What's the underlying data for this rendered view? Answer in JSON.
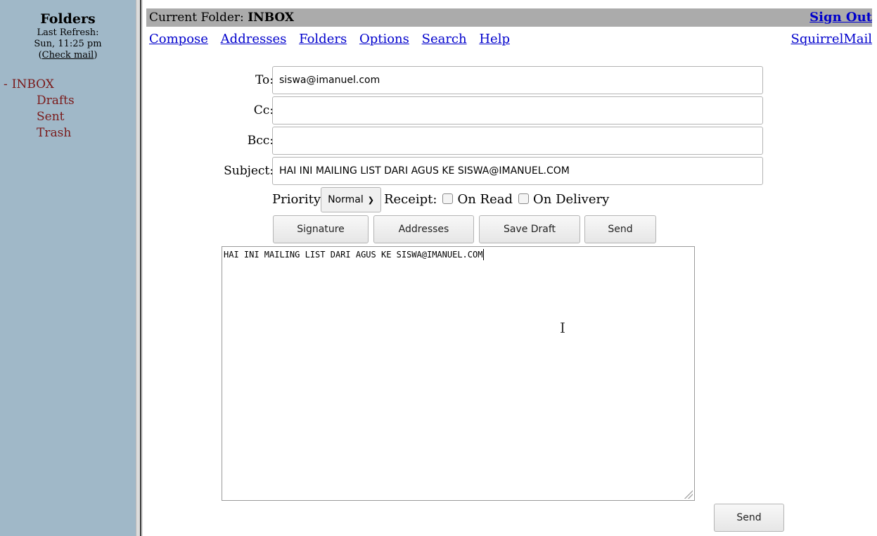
{
  "sidebar": {
    "title": "Folders",
    "refresh_label": "Last Refresh:",
    "refresh_time": "Sun, 11:25 pm",
    "check_mail": "Check mail",
    "folders": [
      {
        "label": "INBOX",
        "prefix": "-"
      },
      {
        "label": "Drafts"
      },
      {
        "label": "Sent"
      },
      {
        "label": "Trash"
      }
    ]
  },
  "header": {
    "current_folder_label": "Current Folder:",
    "current_folder": "INBOX",
    "sign_out": "Sign Out",
    "brand": "SquirrelMail",
    "nav": [
      "Compose",
      "Addresses",
      "Folders",
      "Options",
      "Search",
      "Help"
    ]
  },
  "compose": {
    "to_label": "To:",
    "to_value": "siswa@imanuel.com",
    "cc_label": "Cc:",
    "cc_value": "",
    "bcc_label": "Bcc:",
    "bcc_value": "",
    "subject_label": "Subject:",
    "subject_value": "HAI INI MAILING LIST DARI AGUS KE SISWA@IMANUEL.COM",
    "priority_label": "Priority",
    "priority_value": "Normal",
    "receipt_label": "Receipt:",
    "on_read_label": "On Read",
    "on_delivery_label": "On Delivery",
    "buttons": {
      "signature": "Signature",
      "addresses": "Addresses",
      "save_draft": "Save Draft",
      "send": "Send"
    },
    "body": "HAI INI MAILING LIST DARI AGUS KE SISWA@IMANUEL.COM",
    "bottom_send": "Send"
  },
  "colors": {
    "sidebar_bg": "#a0b8c8",
    "folder_link": "#7a1a1a",
    "nav_link": "#0000cc",
    "top_bar_bg": "#ababab"
  }
}
